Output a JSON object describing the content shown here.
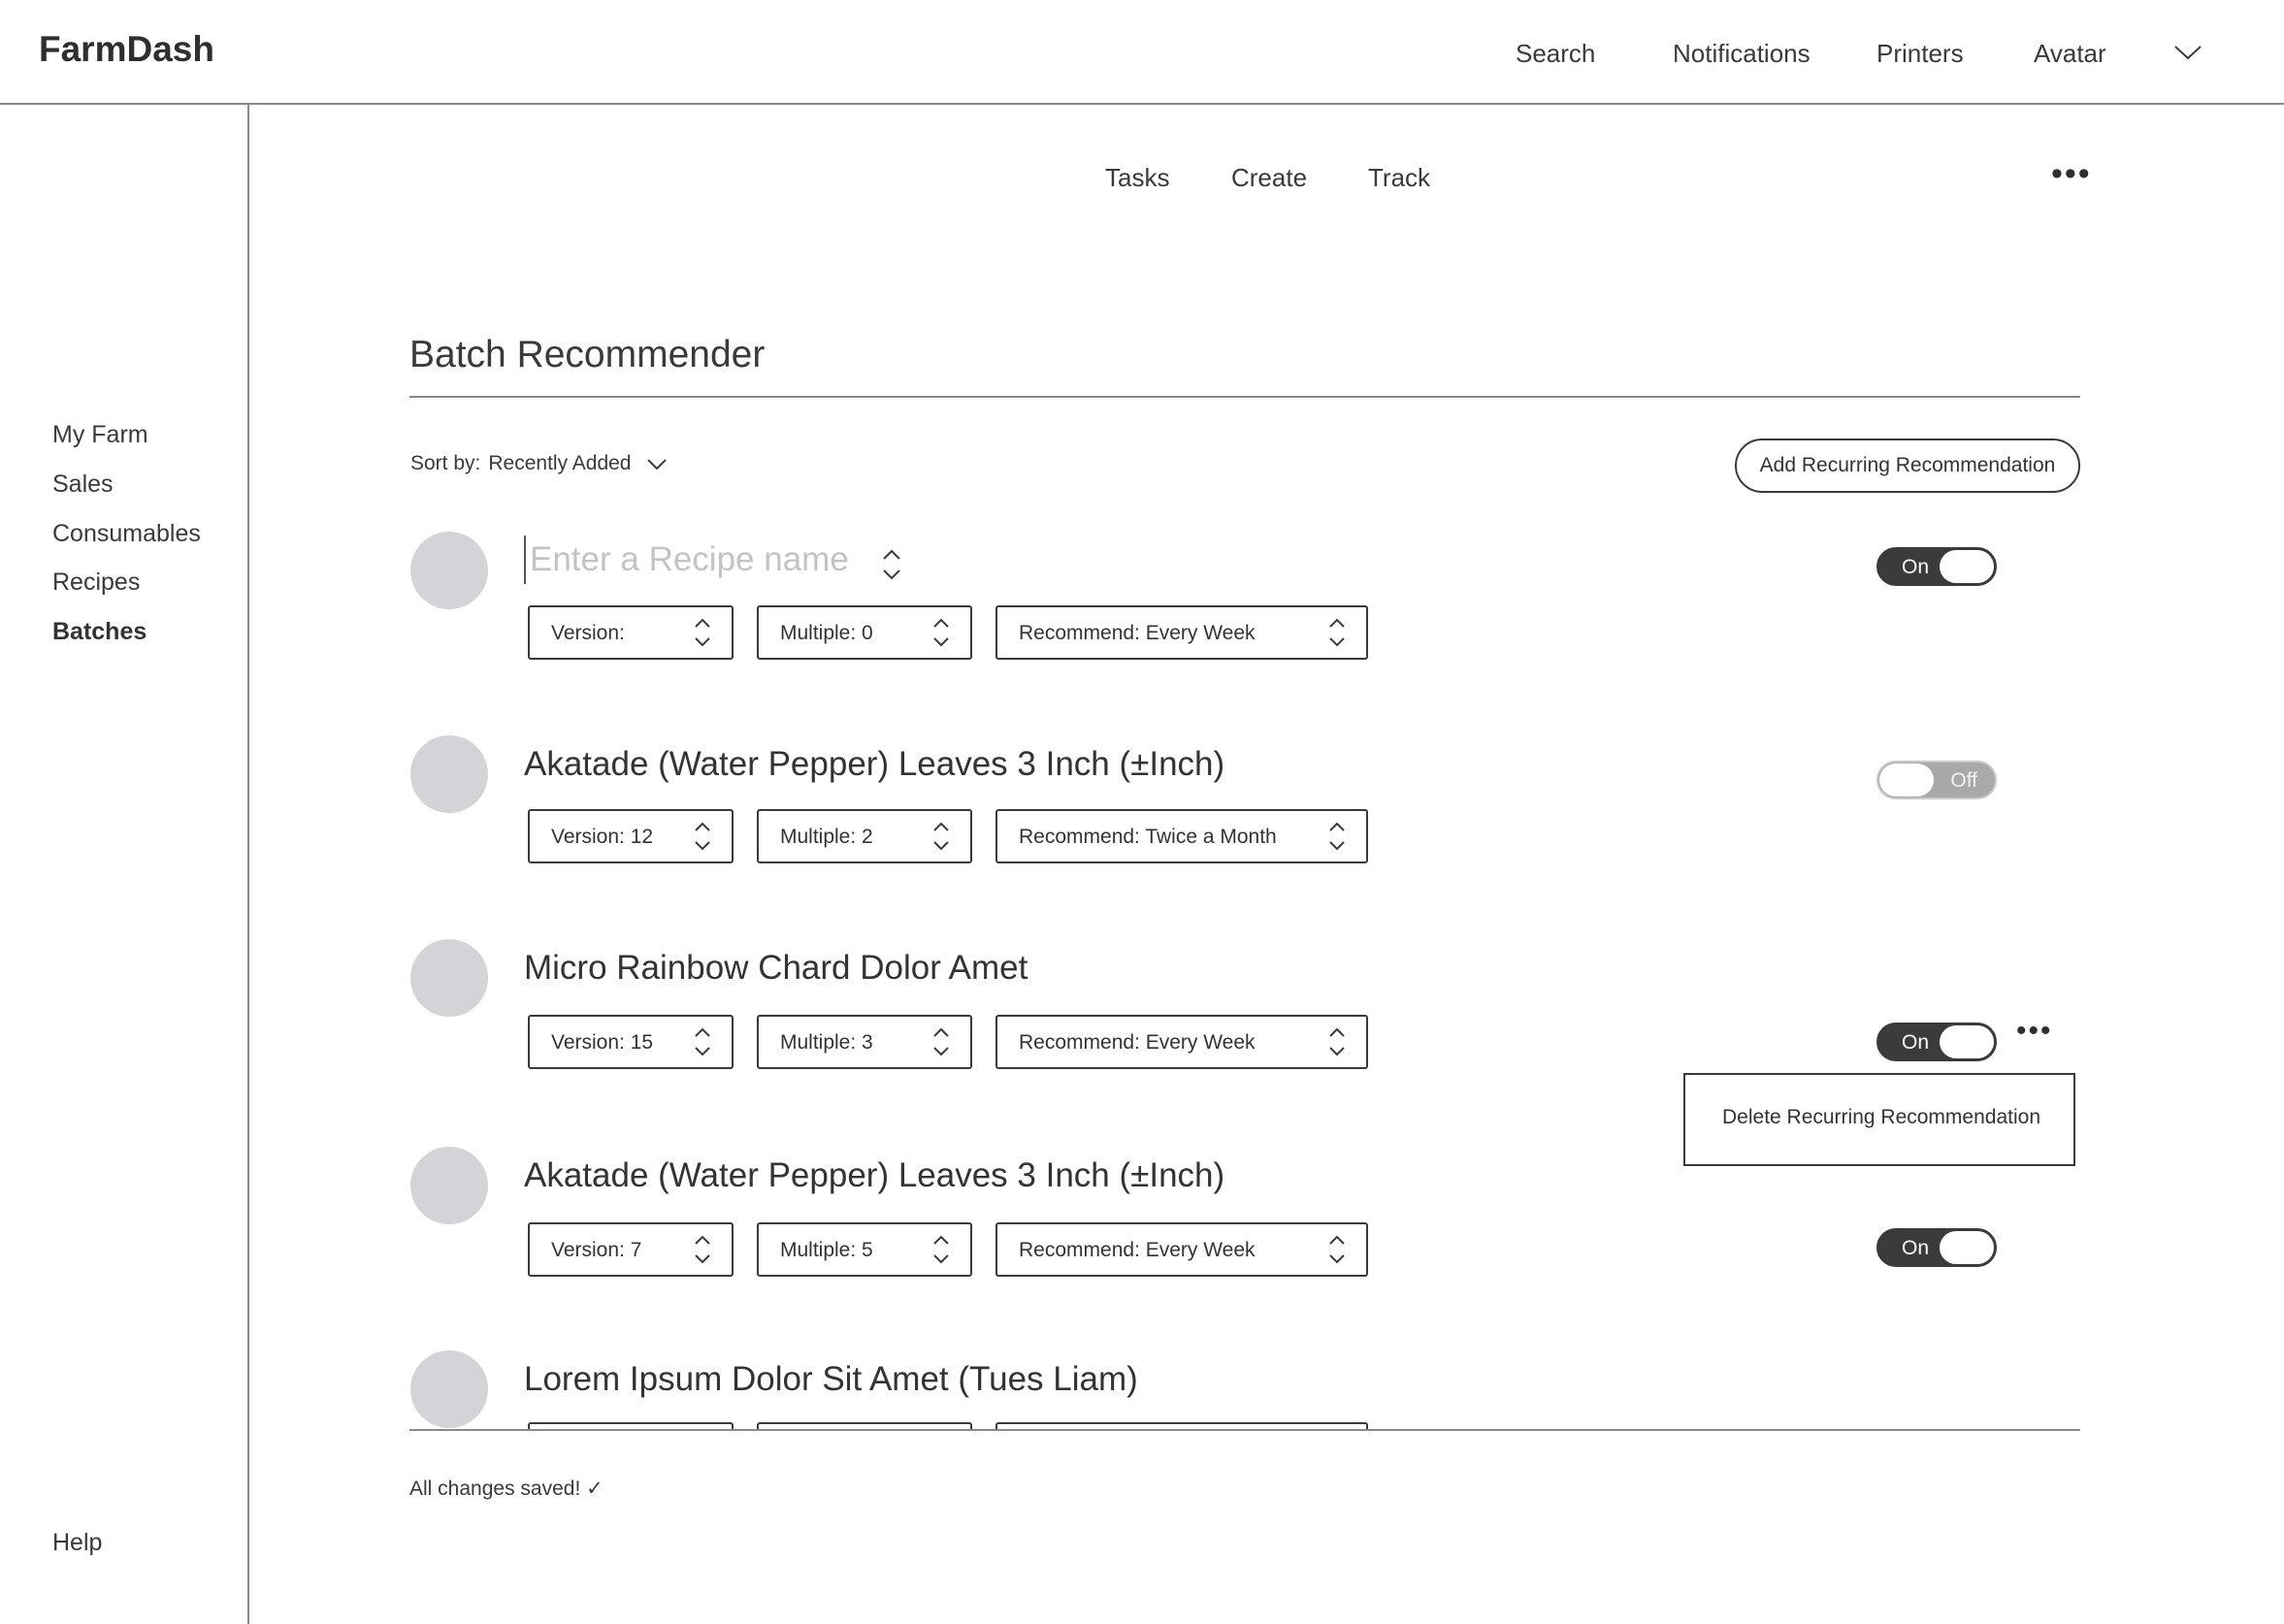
{
  "app": {
    "brand": "FarmDash"
  },
  "topnav": {
    "search": "Search",
    "notifications": "Notifications",
    "printers": "Printers",
    "avatar": "Avatar",
    "chevron_icon": "chevron-down-icon"
  },
  "sidebar": {
    "items": [
      {
        "label": "My Farm",
        "active": false
      },
      {
        "label": "Sales",
        "active": false
      },
      {
        "label": "Consumables",
        "active": false
      },
      {
        "label": "Recipes",
        "active": false
      },
      {
        "label": "Batches",
        "active": true
      }
    ],
    "help": "Help"
  },
  "subnav": {
    "tabs": [
      "Tasks",
      "Create",
      "Track"
    ],
    "more_icon": "more-horizontal-icon"
  },
  "main": {
    "title": "Batch Recommender",
    "sort_label": "Sort by:",
    "sort_value": "Recently Added",
    "add_button": "Add Recurring Recommendation"
  },
  "new_row": {
    "placeholder": "Enter a Recipe name",
    "version": "Version:",
    "multiple": "Multiple: 0",
    "recommend": "Recommend: Every Week",
    "toggle": "On"
  },
  "rows": [
    {
      "name": "Akatade (Water Pepper) Leaves 3 Inch (±Inch)",
      "version": "Version: 12",
      "multiple": "Multiple: 2",
      "recommend": "Recommend: Twice a Month",
      "toggle": "Off"
    },
    {
      "name": "Micro Rainbow Chard Dolor Amet",
      "version": "Version: 15",
      "multiple": "Multiple: 3",
      "recommend": "Recommend: Every Week",
      "toggle": "On"
    },
    {
      "name": "Akatade (Water Pepper) Leaves 3 Inch (±Inch)",
      "version": "Version: 7",
      "multiple": "Multiple: 5",
      "recommend": "Recommend: Every Week",
      "toggle": "On"
    },
    {
      "name": "Lorem Ipsum Dolor Sit Amet (Tues Liam)"
    }
  ],
  "row_menu": {
    "delete": "Delete Recurring Recommendation"
  },
  "status": {
    "saved": "All changes saved! ✓"
  },
  "colors": {
    "toggle_on": "#3b3b3b",
    "toggle_off": "#a9a9a9",
    "avatar_placeholder": "#d3d3d8"
  }
}
